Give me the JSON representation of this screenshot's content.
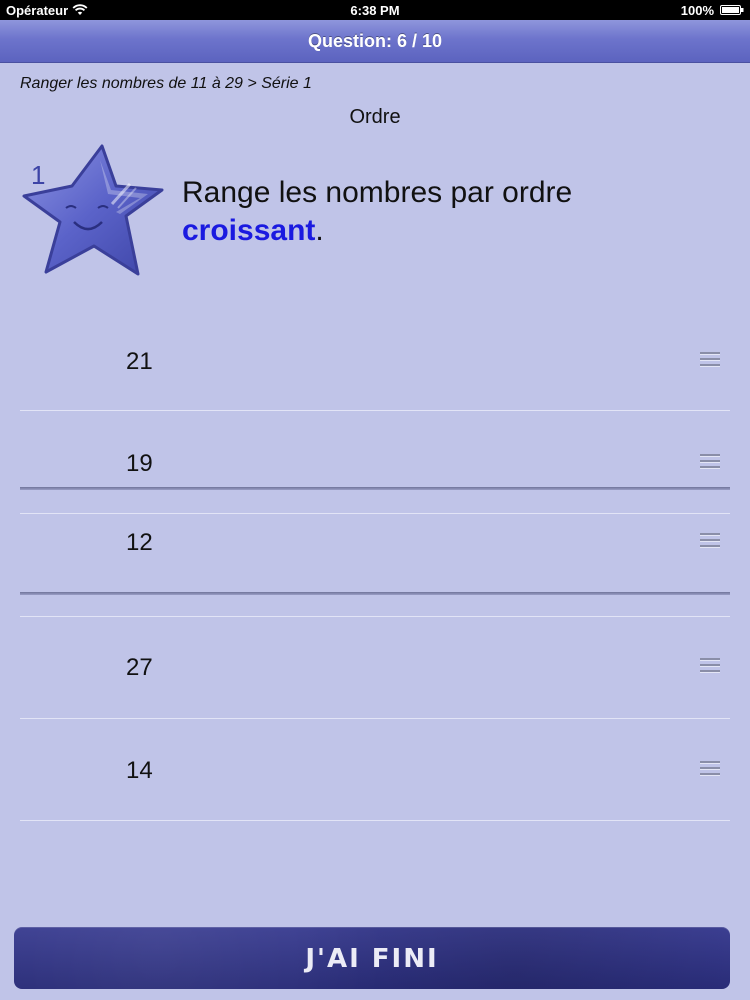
{
  "status_bar": {
    "carrier": "Opérateur",
    "time": "6:38 PM",
    "battery": "100%"
  },
  "nav": {
    "title": "Question: 6 / 10"
  },
  "breadcrumb": "Ranger les nombres de 11 à 29 > Série 1",
  "section_title": "Ordre",
  "star": {
    "number": "1",
    "color": "#5a63c8"
  },
  "instruction": {
    "text": "Range les nombres par ordre",
    "keyword": "croissant",
    "suffix": "."
  },
  "list": {
    "items": [
      {
        "value": "21"
      },
      {
        "value": "19"
      },
      {
        "value": "12"
      },
      {
        "value": "27"
      },
      {
        "value": "14"
      }
    ]
  },
  "done_button": {
    "label": "J'AI FINI"
  },
  "colors": {
    "background": "#c0c4e8",
    "nav": "#6d74cc",
    "accent": "#1a1ae0",
    "button": "#2f3282"
  }
}
